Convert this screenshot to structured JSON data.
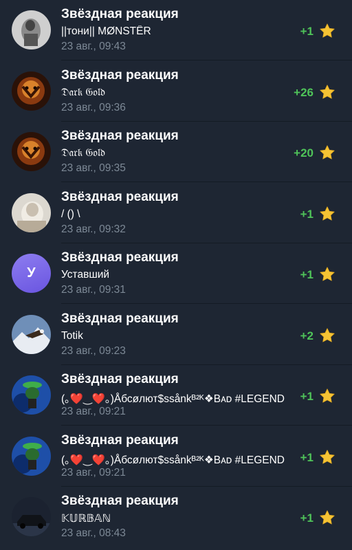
{
  "colors": {
    "background": "#1e2633",
    "amount": "#4fc359",
    "timestamp": "#7d8996",
    "star": "#f5c334",
    "avatar_letter_bg": "#7c68e8"
  },
  "notifications": [
    {
      "title": "Звёздная реакция",
      "name": "||тони|| MØNSTÊR",
      "time": "23 авг., 09:43",
      "amount": "+1",
      "icon": "star-icon"
    },
    {
      "title": "Звёздная реакция",
      "name": "𝔇𝔞𝔯𝔨 𝔊𝔬𝔩𝔡",
      "time": "23 авг., 09:36",
      "amount": "+26",
      "icon": "star-icon"
    },
    {
      "title": "Звёздная реакция",
      "name": "𝔇𝔞𝔯𝔨 𝔊𝔬𝔩𝔡",
      "time": "23 авг., 09:35",
      "amount": "+20",
      "icon": "star-icon"
    },
    {
      "title": "Звёздная реакция",
      "name": "/ () \\",
      "time": "23 авг., 09:32",
      "amount": "+1",
      "icon": "star-icon"
    },
    {
      "title": "Звёздная реакция",
      "name": "Уставший",
      "time": "23 авг., 09:31",
      "amount": "+1",
      "icon": "star-icon",
      "avatar_letter": "У"
    },
    {
      "title": "Звёздная реакция",
      "name": "Totik",
      "time": "23 авг., 09:23",
      "amount": "+2",
      "icon": "star-icon"
    },
    {
      "title": "Звёздная реакция",
      "name": "(｡❤️‿❤️｡)Åбсøлют$ssånkᴮ²ᴷ❖Bᴀᴅ #LEGEND",
      "time": "23 авг., 09:21",
      "amount": "+1",
      "icon": "star-icon"
    },
    {
      "title": "Звёздная реакция",
      "name": "(｡❤️‿❤️｡)Åбсøлют$ssånkᴮ²ᴷ❖Bᴀᴅ #LEGEND",
      "time": "23 авг., 09:21",
      "amount": "+1",
      "icon": "star-icon"
    },
    {
      "title": "Звёздная реакция",
      "name": "𝕂𝕌ℝ𝔹𝔸ℕ",
      "time": "23 авг., 08:43",
      "amount": "+1",
      "icon": "star-icon"
    }
  ]
}
